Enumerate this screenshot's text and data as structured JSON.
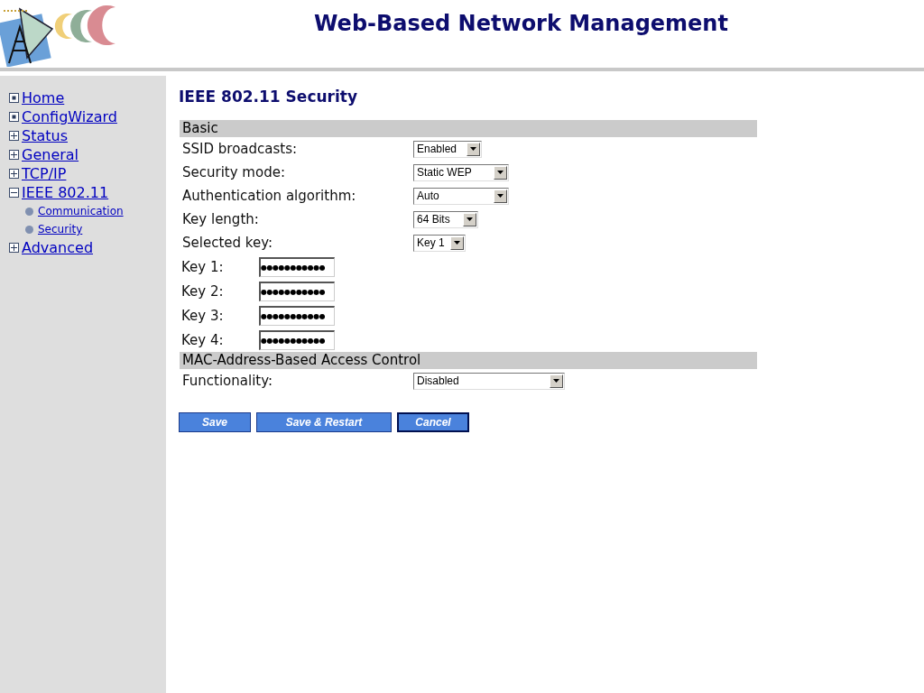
{
  "header": {
    "title": "Web-Based Network Management"
  },
  "sidebar": {
    "items": [
      {
        "label": "Home",
        "kind": "leaf"
      },
      {
        "label": "ConfigWizard",
        "kind": "leaf"
      },
      {
        "label": "Status",
        "kind": "folder",
        "expanded": false
      },
      {
        "label": "General",
        "kind": "folder",
        "expanded": false
      },
      {
        "label": "TCP/IP",
        "kind": "folder",
        "expanded": false
      },
      {
        "label": "IEEE 802.11",
        "kind": "folder",
        "expanded": true,
        "children": [
          {
            "label": "Communication"
          },
          {
            "label": "Security"
          }
        ]
      },
      {
        "label": "Advanced",
        "kind": "folder",
        "expanded": false
      }
    ]
  },
  "page": {
    "title": "IEEE 802.11 Security",
    "sections": [
      {
        "title": "Basic",
        "fields": [
          {
            "label": "SSID broadcasts:",
            "kind": "select",
            "value": "Enabled"
          },
          {
            "label": "Security mode:",
            "kind": "select",
            "value": "Static WEP"
          },
          {
            "label": "Authentication algorithm:",
            "kind": "select",
            "value": "Auto"
          },
          {
            "label": "Key length:",
            "kind": "select",
            "value": "64 Bits"
          },
          {
            "label": "Selected key:",
            "kind": "select",
            "value": "Key 1"
          },
          {
            "label": "Key 1:",
            "kind": "key",
            "value": "●●●●●●●●●●●"
          },
          {
            "label": "Key 2:",
            "kind": "key",
            "value": "●●●●●●●●●●●"
          },
          {
            "label": "Key 3:",
            "kind": "key",
            "value": "●●●●●●●●●●●"
          },
          {
            "label": "Key 4:",
            "kind": "key",
            "value": "●●●●●●●●●●●"
          }
        ]
      },
      {
        "title": "MAC-Address-Based Access Control",
        "fields": [
          {
            "label": "Functionality:",
            "kind": "select",
            "value": "Disabled"
          }
        ]
      }
    ]
  },
  "buttons": [
    {
      "label": "Save",
      "focused": false
    },
    {
      "label": "Save & Restart",
      "focused": false
    },
    {
      "label": "Cancel",
      "focused": true
    }
  ]
}
